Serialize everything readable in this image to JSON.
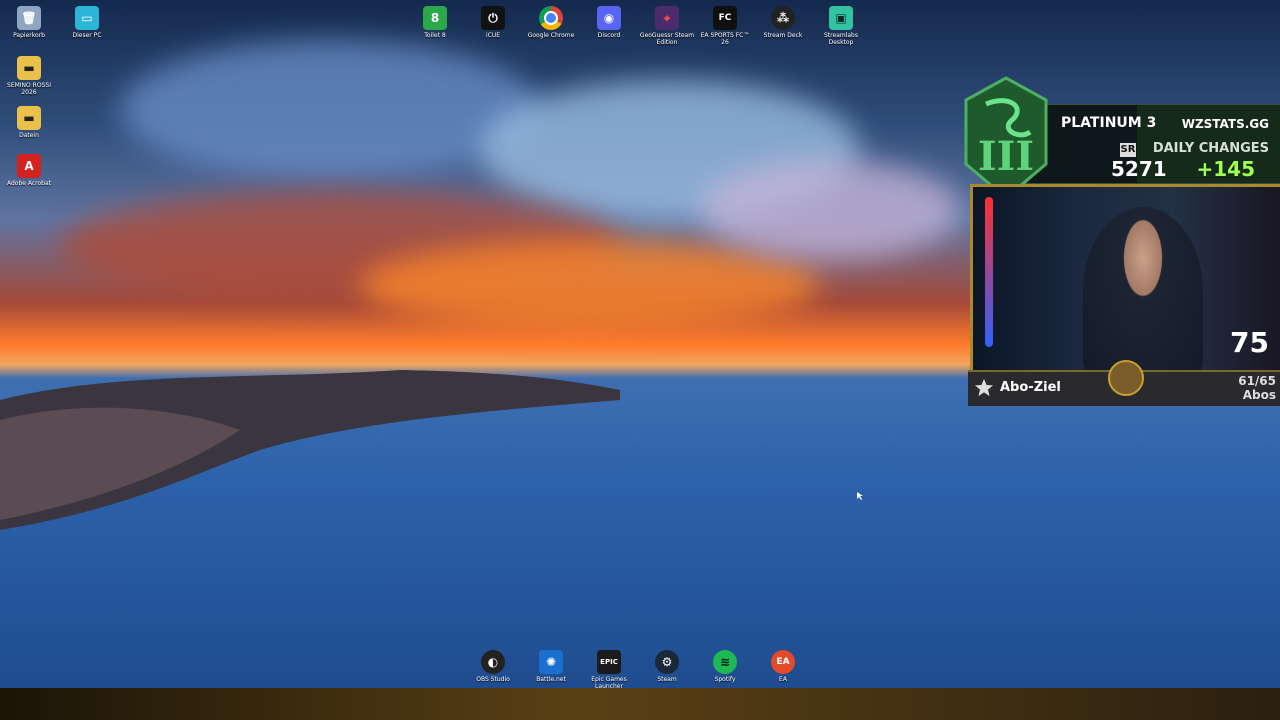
{
  "desktop_left": [
    {
      "name": "recycle-bin",
      "label": "Papierkorb",
      "icon": "recycle-bin-icon"
    },
    {
      "name": "this-pc",
      "label": "Dieser PC",
      "icon": "monitor-icon"
    },
    {
      "name": "folder-semino",
      "label": "SEMINO ROSSI 2026",
      "icon": "folder-icon"
    },
    {
      "name": "folder-datein",
      "label": "Datein",
      "icon": "folder-icon"
    },
    {
      "name": "adobe-acrobat",
      "label": "Adobe Acrobat",
      "icon": "pdf-icon"
    }
  ],
  "desktop_top": [
    {
      "name": "toilet-8",
      "label": "Toilet 8",
      "glyph": "8",
      "color": "#2aa84a"
    },
    {
      "name": "icue",
      "label": "iCUE",
      "glyph": "⏻",
      "color": "#111111"
    },
    {
      "name": "google-chrome",
      "label": "Google Chrome",
      "glyph": "●",
      "color": "#e3a21a"
    },
    {
      "name": "discord",
      "label": "Discord",
      "glyph": "◉",
      "color": "#5865f2"
    },
    {
      "name": "geoguessr",
      "label": "GeoGuessr Steam Edition",
      "glyph": "⌖",
      "color": "#4a2b6b"
    },
    {
      "name": "ea-sports-fc",
      "label": "EA SPORTS FC™ 26",
      "glyph": "FC",
      "color": "#101010"
    },
    {
      "name": "stream-deck",
      "label": "Stream Deck",
      "glyph": "⁂",
      "color": "#222222"
    },
    {
      "name": "streamlabs",
      "label": "Streamlabs Desktop",
      "glyph": "▣",
      "color": "#31c3a2"
    }
  ],
  "taskbar_icons": [
    {
      "name": "obs-studio",
      "label": "OBS Studio",
      "glyph": "◐",
      "color": "#222222"
    },
    {
      "name": "battle-net",
      "label": "Battle.net",
      "glyph": "✺",
      "color": "#1a6fd0"
    },
    {
      "name": "epic-games",
      "label": "Epic Games Launcher",
      "glyph": "EPIC",
      "color": "#1b1b1b"
    },
    {
      "name": "steam",
      "label": "Steam",
      "glyph": "⚙",
      "color": "#1b2838"
    },
    {
      "name": "spotify",
      "label": "Spotify",
      "glyph": "≋",
      "color": "#1db954"
    },
    {
      "name": "ea",
      "label": "EA",
      "glyph": "EA",
      "color": "#e24a2a"
    }
  ],
  "overlay": {
    "rank": "PLATINUM 3",
    "sr_label": "SR",
    "sr_value": "5271",
    "site": "WZSTATS.GG",
    "daily_changes_label": "DAILY CHANGES",
    "daily_changes_value": "+145",
    "cam_number": "75",
    "goal_label": "Abo-Ziel",
    "goal_count": "61/65",
    "goal_unit": "Abos",
    "colors": {
      "accent_green": "#9fff52",
      "frame_gold": "#a98b2b",
      "emblem_green": "#2d7a3d"
    }
  }
}
